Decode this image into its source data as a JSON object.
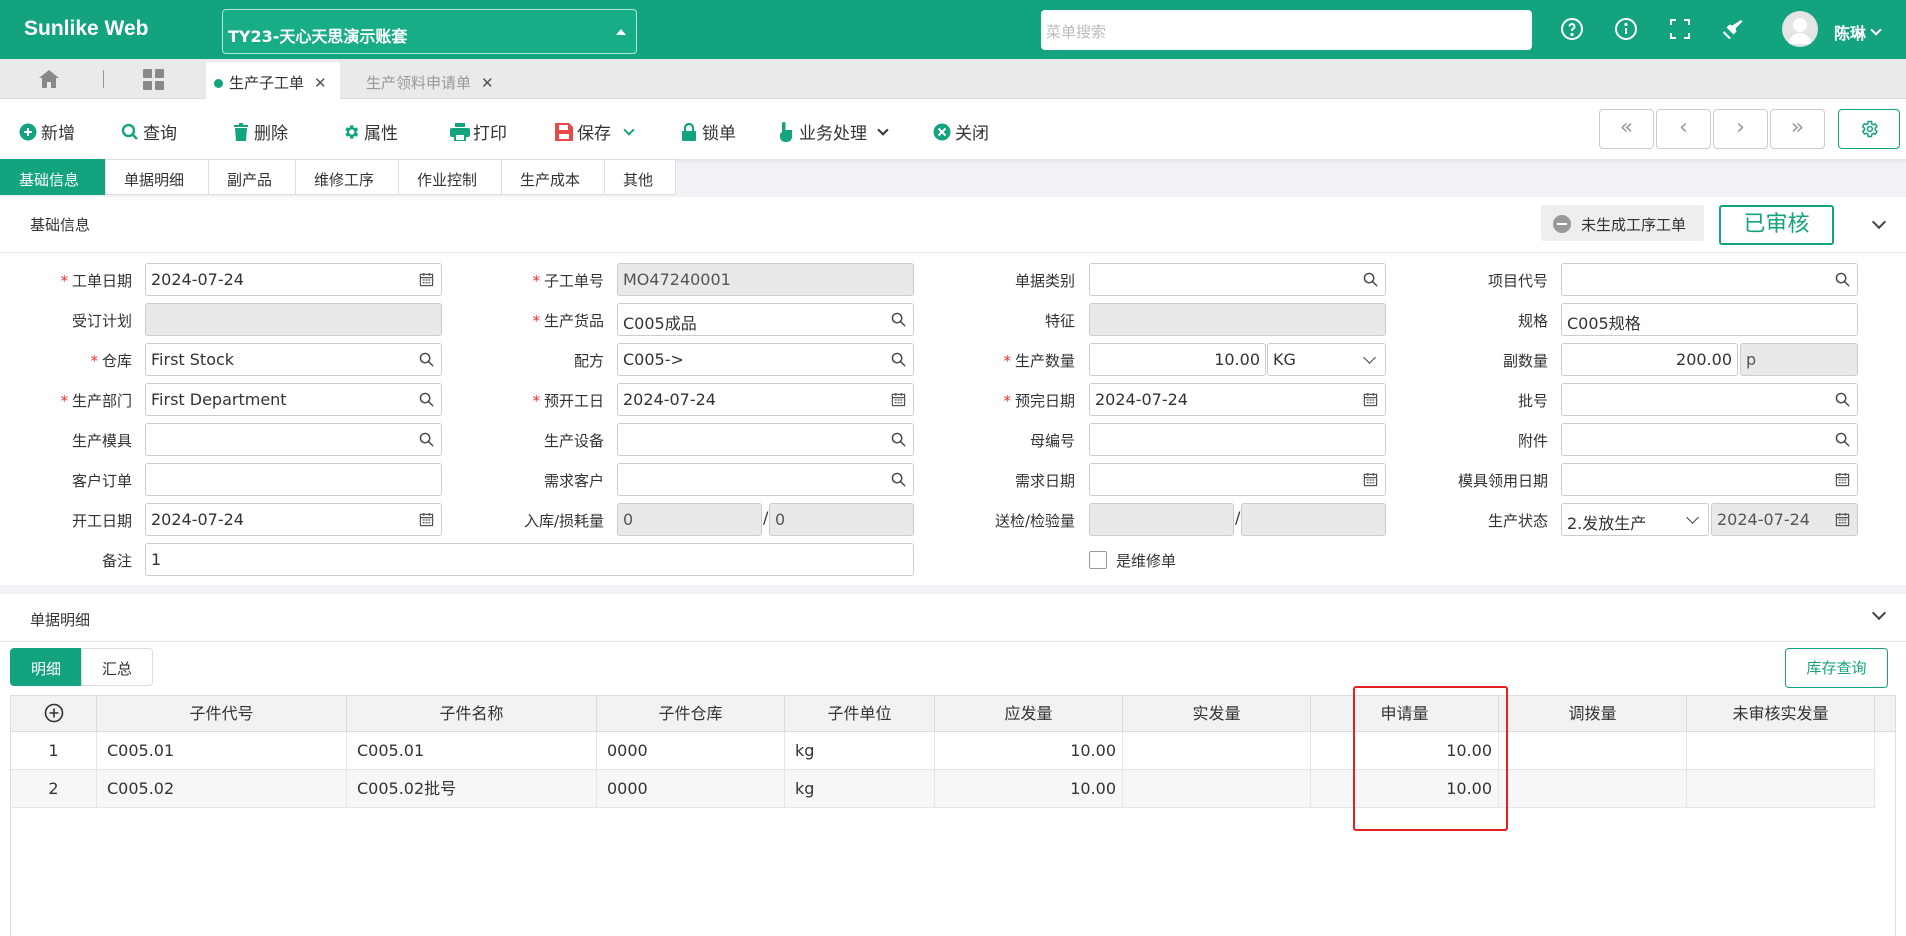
{
  "header": {
    "logo": "Sunlike Web",
    "account": "TY23-天心天思演示账套",
    "menu_search_placeholder": "菜单搜索",
    "user": "陈琳"
  },
  "tabs": [
    {
      "label": "生产子工单",
      "active": true
    },
    {
      "label": "生产领料申请单",
      "active": false
    }
  ],
  "toolbar": {
    "add": "新增",
    "query": "查询",
    "delete": "删除",
    "properties": "属性",
    "print": "打印",
    "save": "保存",
    "lock": "锁单",
    "business": "业务处理",
    "close": "关闭"
  },
  "subtabs": [
    "基础信息",
    "单据明细",
    "副产品",
    "维修工序",
    "作业控制",
    "生产成本",
    "其他"
  ],
  "basic": {
    "title": "基础信息",
    "badge_status": "未生成工序工单",
    "badge_audit": "已审核",
    "labels": {
      "order_date": "工单日期",
      "sub_order_no": "子工单号",
      "doc_type": "单据类别",
      "project_code": "项目代号",
      "order_plan": "受订计划",
      "product": "生产货品",
      "feature": "特征",
      "spec": "规格",
      "warehouse": "仓库",
      "formula": "配方",
      "quantity": "生产数量",
      "sub_qty": "副数量",
      "department": "生产部门",
      "plan_start": "预开工日",
      "plan_finish": "预完日期",
      "batch": "批号",
      "mold": "生产模具",
      "equipment": "生产设备",
      "parent_no": "母编号",
      "attachment": "附件",
      "customer_order": "客户订单",
      "demand_customer": "需求客户",
      "demand_date": "需求日期",
      "mold_date": "模具领用日期",
      "start_date": "开工日期",
      "in_loss": "入库/损耗量",
      "inspect": "送检/检验量",
      "prod_status": "生产状态",
      "remark": "备注",
      "repair": "是维修单"
    },
    "values": {
      "order_date": "2024-07-24",
      "sub_order_no": "MO47240001",
      "doc_type": "",
      "project_code": "",
      "order_plan": "",
      "product": "C005成品",
      "feature": "",
      "spec": "C005规格",
      "warehouse": "First Stock",
      "formula": "C005->",
      "quantity": "10.00",
      "unit": "KG",
      "sub_qty": "200.00",
      "sub_unit": "p",
      "department": "First Department",
      "plan_start": "2024-07-24",
      "plan_finish": "2024-07-24",
      "batch": "",
      "mold": "",
      "equipment": "",
      "parent_no": "",
      "attachment": "",
      "customer_order": "",
      "demand_customer": "",
      "demand_date": "",
      "mold_date": "",
      "start_date": "2024-07-24",
      "in_qty": "0",
      "loss_qty": "0",
      "inspect_qty": "",
      "checked_qty": "",
      "prod_status": "2.发放生产",
      "status_date": "2024-07-24",
      "remark": "1",
      "repair_checked": false
    }
  },
  "detail": {
    "title": "单据明细",
    "seg_detail": "明细",
    "seg_summary": "汇总",
    "stock_query": "库存查询",
    "columns": [
      "子件代号",
      "子件名称",
      "子件仓库",
      "子件单位",
      "应发量",
      "实发量",
      "申请量",
      "调拨量",
      "未审核实发量"
    ],
    "rows": [
      {
        "no": "1",
        "code": "C005.01",
        "name": "C005.01",
        "wh": "0000",
        "unit": "kg",
        "due": "10.00",
        "actual": "",
        "apply": "10.00",
        "transfer": "",
        "unaudited": ""
      },
      {
        "no": "2",
        "code": "C005.02",
        "name": "C005.02批号",
        "wh": "0000",
        "unit": "kg",
        "due": "10.00",
        "actual": "",
        "apply": "10.00",
        "transfer": "",
        "unaudited": ""
      }
    ]
  },
  "colors": {
    "brand": "#14a37f",
    "highlight": "#e42020"
  }
}
